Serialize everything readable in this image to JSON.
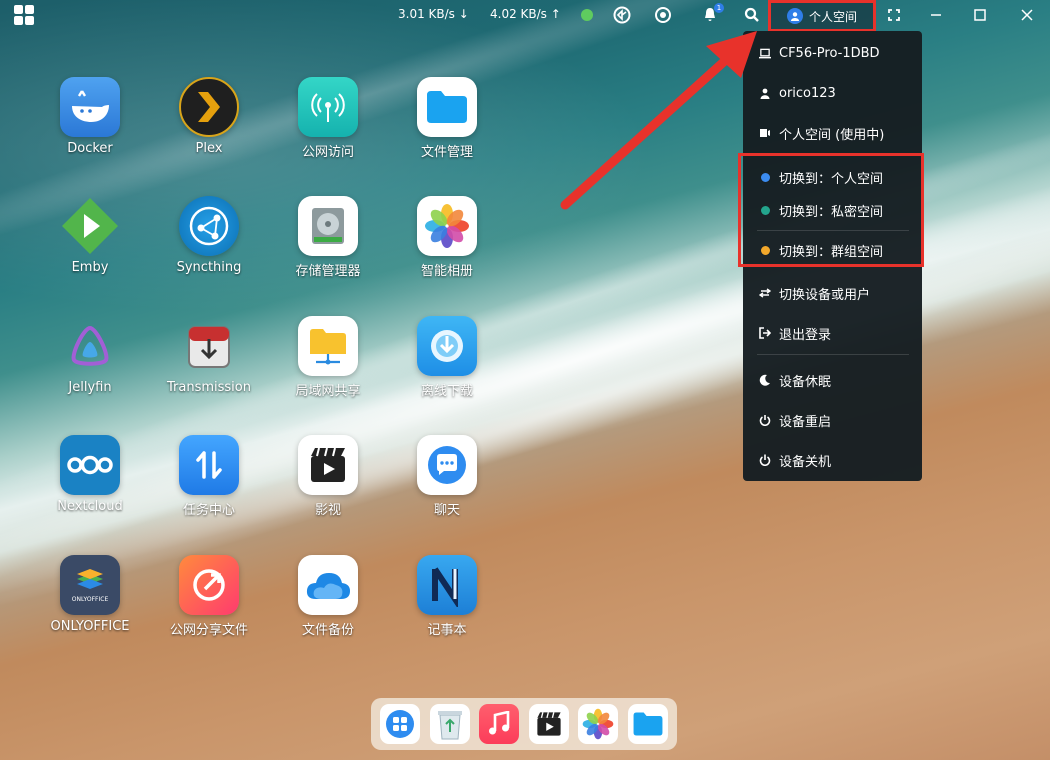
{
  "topbar": {
    "download_speed": "3.01 KB/s",
    "upload_speed": "4.02 KB/s",
    "notification_count": "1",
    "space_label": "个人空间"
  },
  "apps": [
    {
      "label": "Docker",
      "icon": "docker-icon",
      "color": "#3d8fe0"
    },
    {
      "label": "Plex",
      "icon": "plex-icon",
      "color": "#1f1f1f"
    },
    {
      "label": "公网访问",
      "icon": "broadcast-icon",
      "color": "#22c7c1"
    },
    {
      "label": "文件管理",
      "icon": "folder-icon",
      "color": "#ffffff"
    },
    {
      "label": "Emby",
      "icon": "emby-icon",
      "color": "transparent"
    },
    {
      "label": "Syncthing",
      "icon": "syncthing-icon",
      "color": "#1d7fc5"
    },
    {
      "label": "存储管理器",
      "icon": "disk-icon",
      "color": "#ffffff"
    },
    {
      "label": "智能相册",
      "icon": "photos-icon",
      "color": "#ffffff"
    },
    {
      "label": "Jellyfin",
      "icon": "jellyfin-icon",
      "color": "transparent"
    },
    {
      "label": "Transmission",
      "icon": "transmission-icon",
      "color": "transparent"
    },
    {
      "label": "局域网共享",
      "icon": "lan-share-icon",
      "color": "#ffffff"
    },
    {
      "label": "离线下载",
      "icon": "offline-download-icon",
      "color": "#2fa8ef"
    },
    {
      "label": "Nextcloud",
      "icon": "nextcloud-icon",
      "color": "#1a82c4"
    },
    {
      "label": "任务中心",
      "icon": "task-center-icon",
      "color": "#2c8cf0"
    },
    {
      "label": "影视",
      "icon": "video-icon",
      "color": "#ffffff"
    },
    {
      "label": "聊天",
      "icon": "chat-icon",
      "color": "#ffffff"
    },
    {
      "label": "ONLYOFFICE",
      "icon": "onlyoffice-icon",
      "color": "#3a4a66"
    },
    {
      "label": "公网分享文件",
      "icon": "share-file-icon",
      "color": "#ff4f5c"
    },
    {
      "label": "文件备份",
      "icon": "backup-cloud-icon",
      "color": "#ffffff"
    },
    {
      "label": "记事本",
      "icon": "notepad-icon",
      "color": "#2a9be8"
    }
  ],
  "menu": {
    "device": "CF56-Pro-1DBD",
    "user": "orico123",
    "current_space": "个人空间 (使用中)",
    "switch_personal": "切换到：个人空间",
    "switch_private": "切换到：私密空间",
    "switch_group": "切换到：群组空间",
    "switch_device": "切换设备或用户",
    "logout": "退出登录",
    "sleep": "设备休眠",
    "restart": "设备重启",
    "shutdown": "设备关机",
    "dot_colors": {
      "personal": "#3b8cf0",
      "private": "#23a58d",
      "group": "#f2a82b"
    }
  },
  "dock": [
    {
      "icon": "app-grid-icon"
    },
    {
      "icon": "recycle-bin-icon"
    },
    {
      "icon": "music-icon"
    },
    {
      "icon": "video-icon"
    },
    {
      "icon": "photos-icon"
    },
    {
      "icon": "folder-icon"
    }
  ]
}
